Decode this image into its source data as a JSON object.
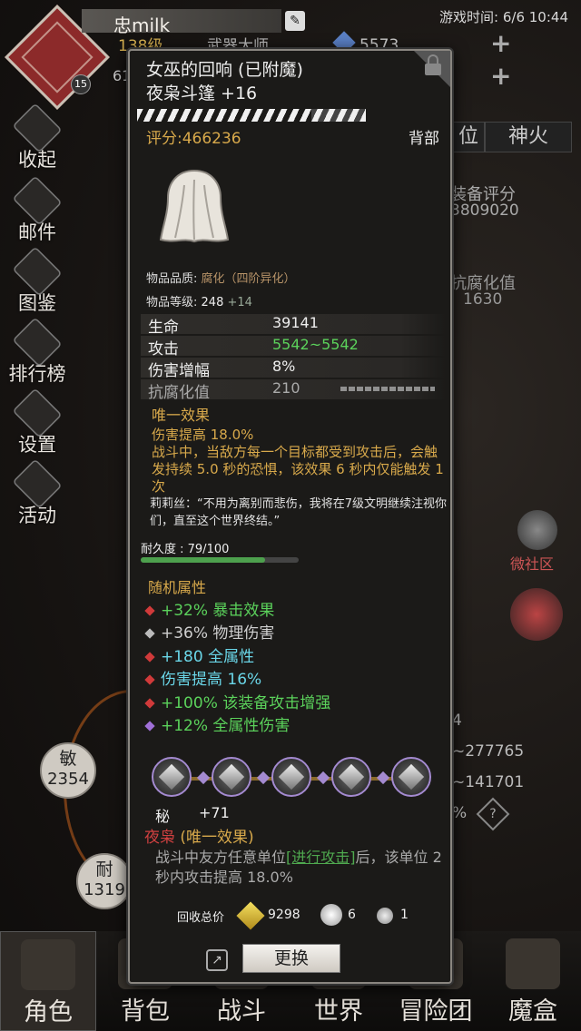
{
  "player": {
    "name": "忠milk",
    "level": "138级",
    "title": "武器大师",
    "avatar_level": "15",
    "gems": "5573",
    "fragment_count": "61"
  },
  "status": {
    "game_time": "游戏时间: 6/6 10:44"
  },
  "side_menu": [
    {
      "label": "收起",
      "icon": "collapse-icon"
    },
    {
      "label": "邮件",
      "icon": "mail-icon"
    },
    {
      "label": "图鉴",
      "icon": "book-icon"
    },
    {
      "label": "排行榜",
      "icon": "ranking-icon"
    },
    {
      "label": "设置",
      "icon": "gear-icon"
    },
    {
      "label": "活动",
      "icon": "event-icon"
    }
  ],
  "right_panel": {
    "tab_partial": "位",
    "tab_shenhuo": "神火",
    "equip_score_label": "装备评分",
    "equip_score_value": "3809020",
    "corrupt_label": "抗腐化值",
    "corrupt_value": "1630",
    "community_label": "微社区",
    "stat_1": "4",
    "stat_2": "~277765",
    "stat_3": "~141701",
    "stat_4": "%"
  },
  "attr_bubbles": {
    "min_key": "敏",
    "min_val": "2354",
    "nai_key": "耐",
    "nai_val": "1319"
  },
  "bottom_nav": [
    {
      "label": "角色",
      "icon": "helmet-icon"
    },
    {
      "label": "背包",
      "icon": "bag-icon"
    },
    {
      "label": "战斗",
      "icon": "sword-icon"
    },
    {
      "label": "世界",
      "icon": "globe-icon"
    },
    {
      "label": "冒险团",
      "icon": "team-icon"
    },
    {
      "label": "魔盒",
      "icon": "magic-box-icon"
    }
  ],
  "item": {
    "name": "女巫的回响 (已附魔)",
    "sub": "夜枭斗篷 +16",
    "score": "评分:466236",
    "slot": "背部",
    "quality_label": "物品品质:",
    "quality_value": "腐化（四阶异化）",
    "ilvl_label": "物品等级:",
    "ilvl_value": "248",
    "ilvl_plus": "+14",
    "stats": [
      {
        "key": "生命",
        "value": "39141"
      },
      {
        "key": "攻击",
        "value": "5542~5542"
      },
      {
        "key": "伤害增幅",
        "value": "8%"
      },
      {
        "key": "抗腐化值",
        "value": "210"
      }
    ],
    "unique_title": "唯一效果",
    "unique_line1": "伤害提高 18.0%",
    "unique_line2": "战斗中，当敌方每一个目标都受到攻击后，会触发持续 5.0 秒的恐惧，该效果 6 秒内仅能触发 1 次",
    "quote": "莉莉丝：“不用为离别而悲伤，我将在7级文明继续注视你们，直至这个世界终结。”",
    "durability_label": "耐久度 : 79/100",
    "durability": 0.79,
    "random_title": "随机属性",
    "random": [
      {
        "text": "+32% 暴击效果",
        "color": "#5bd25b",
        "gem": "#d03a3a"
      },
      {
        "text": "+36% 物理伤害",
        "color": "#cfcfcf",
        "gem": "#bbbbbb"
      },
      {
        "text": "+180 全属性",
        "color": "#6ad6e8",
        "gem": "#d03a3a"
      },
      {
        "text": "伤害提高 16%",
        "color": "#6ad6e8",
        "gem": "#d03a3a"
      },
      {
        "text": "+100% 该装备攻击增强",
        "color": "#5bd25b",
        "gem": "#d03a3a"
      },
      {
        "text": "+12% 全属性伤害",
        "color": "#5bd25b",
        "gem": "#a070d8"
      }
    ],
    "secret_label": "秘",
    "secret_value": "+71",
    "set_name": "夜枭",
    "set_unique": "(唯一效果)",
    "set_desc_pre": "战斗中友方任意单位",
    "set_desc_link": "[进行攻击]",
    "set_desc_post": "后，该单位 2 秒内攻击提高 18.0%",
    "recycle_label": "回收总价",
    "recycle_gold": "9298",
    "recycle_star": "6",
    "recycle_dot": "1",
    "replace_label": "更换"
  }
}
